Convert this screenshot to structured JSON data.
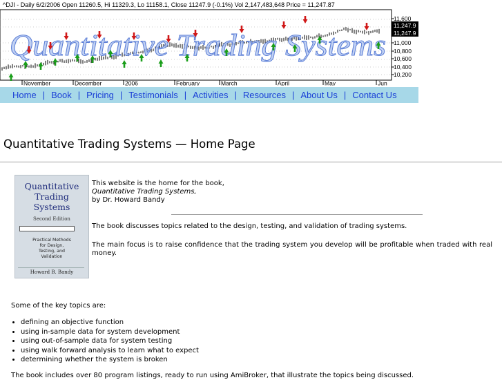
{
  "banner": {
    "chart_caption": "^DJI - Daily 6/2/2006 Open 11260.5, Hi 11329.3, Lo 11158.1, Close 11247.9 (-0.1%) Vol 2,147,483,648 Price = 11,247.87",
    "watermark": "Quantitative Trading Systems",
    "price_labels": [
      "11,600",
      "11,247.9",
      "11,247.9",
      "11,000",
      "10,800",
      "10,600",
      "10,400",
      "10,200"
    ],
    "month_labels": [
      "November",
      "December",
      "2006",
      "February",
      "March",
      "April",
      "May",
      "Jun"
    ],
    "colors": {
      "up_arrow": "#1a9e1a",
      "down_arrow": "#d01818",
      "price_tag": "#000000",
      "watermark": "#8aa7e8"
    }
  },
  "nav": {
    "items": [
      "Home",
      "Book",
      "Pricing",
      "Testimonials",
      "Activities",
      "Resources",
      "About Us",
      "Contact Us"
    ],
    "background": "#a7d8e8",
    "link_color": "#1a3fd6"
  },
  "page": {
    "title": "Quantitative Trading Systems — Home Page"
  },
  "book_cover": {
    "title_lines": [
      "Quantitative",
      "Trading",
      "Systems"
    ],
    "edition": "Second Edition",
    "subtitle_lines": [
      "Practical Methods",
      "for Design,",
      "Testing, and",
      "Validation"
    ],
    "author": "Howard B. Bandy"
  },
  "intro": {
    "line1": "This website is the home for the book,",
    "line2": "Quantitative Trading Systems,",
    "line3": "by Dr. Howard Bandy"
  },
  "body": {
    "p1": "The book discusses topics related to the design, testing, and validation of trading systems.",
    "p2": "The main focus is to raise confidence that the trading system you develop will be profitable when traded with real money.",
    "topics_heading": "Some of the key topics are:",
    "topics": [
      "defining an objective function",
      "using in-sample data for system development",
      "using out-of-sample data for system testing",
      "using walk forward analysis to learn what to expect",
      "determining whether the system is broken"
    ],
    "p4": "The book includes over 80 program listings, ready to run using AmiBroker, that illustrate the topics being discussed."
  }
}
